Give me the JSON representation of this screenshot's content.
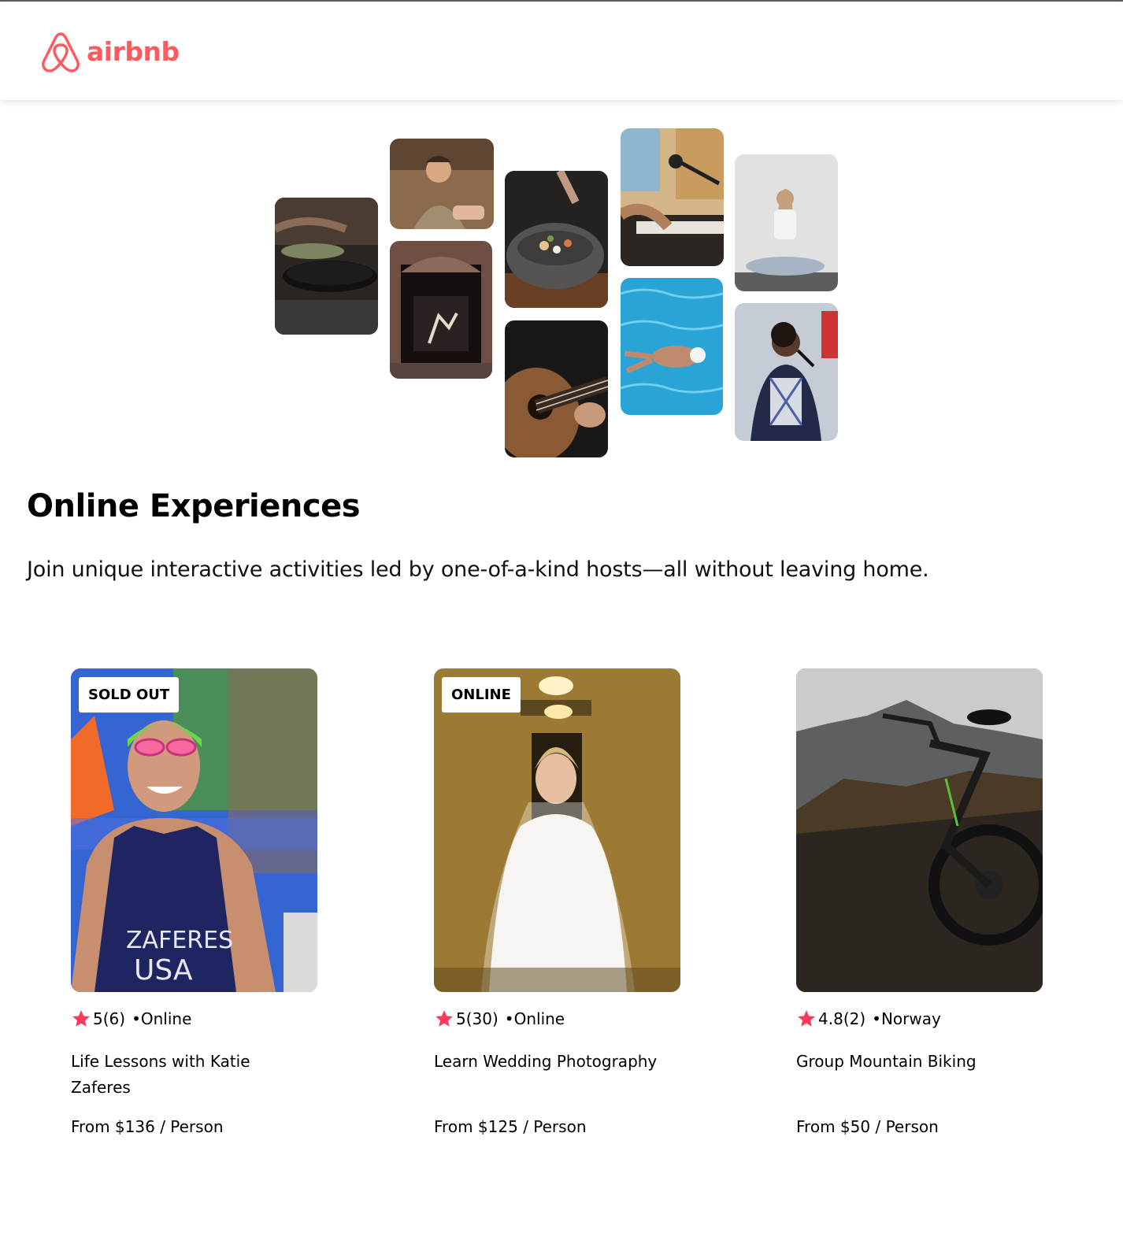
{
  "brand": {
    "name": "airbnb",
    "color": "#FF5A5F"
  },
  "hero": {
    "photos": [
      {
        "subject": "cooking-pans"
      },
      {
        "subject": "woman-cooking"
      },
      {
        "subject": "dancer-doorway"
      },
      {
        "subject": "food-bowl"
      },
      {
        "subject": "guitar"
      },
      {
        "subject": "piano-microphone"
      },
      {
        "subject": "swimmer"
      },
      {
        "subject": "yoga"
      },
      {
        "subject": "singer"
      }
    ]
  },
  "intro": {
    "title": "Online Experiences",
    "subtitle": "Join unique interactive activities led by one-of-a-kind hosts—all without leaving home."
  },
  "cards": [
    {
      "badge": "SOLD OUT",
      "rating": "5",
      "reviews": "(6)",
      "location": "•Online",
      "title": "Life Lessons with Katie Zaferes",
      "price_prefix": "From",
      "price": "$136",
      "price_suffix": "/ Person",
      "image": "athlete-portrait"
    },
    {
      "badge": "ONLINE",
      "rating": "5",
      "reviews": "(30)",
      "location": "•Online",
      "title": "Learn Wedding Photography",
      "price_prefix": "From",
      "price": "$125",
      "price_suffix": "/ Person",
      "image": "bride-portrait"
    },
    {
      "badge": "",
      "rating": "4.8",
      "reviews": "(2)",
      "location": "•Norway",
      "title": "Group Mountain Biking",
      "price_prefix": "From",
      "price": "$50",
      "price_suffix": "/ Person",
      "image": "mountain-bike"
    }
  ],
  "icons": {
    "star": "star-icon",
    "logo": "airbnb-logo-icon"
  },
  "colors": {
    "star": "#FE395A",
    "text": "#000000"
  }
}
